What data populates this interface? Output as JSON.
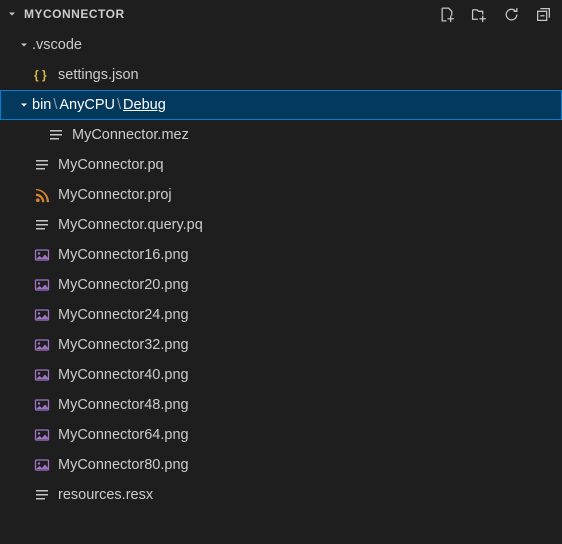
{
  "header": {
    "title": "MYCONNECTOR",
    "actions": {
      "new_file": "New File",
      "new_folder": "New Folder",
      "refresh": "Refresh",
      "collapse": "Collapse All"
    }
  },
  "tree": {
    "folder_vscode": ".vscode",
    "file_settings": "settings.json",
    "folder_bin_seg1": "bin",
    "folder_bin_seg2": "AnyCPU",
    "folder_bin_seg3": "Debug",
    "path_sep": "\\",
    "file_mez": "MyConnector.mez",
    "file_pq": "MyConnector.pq",
    "file_proj": "MyConnector.proj",
    "file_query": "MyConnector.query.pq",
    "file_png16": "MyConnector16.png",
    "file_png20": "MyConnector20.png",
    "file_png24": "MyConnector24.png",
    "file_png32": "MyConnector32.png",
    "file_png40": "MyConnector40.png",
    "file_png48": "MyConnector48.png",
    "file_png64": "MyConnector64.png",
    "file_png80": "MyConnector80.png",
    "file_resx": "resources.resx"
  }
}
